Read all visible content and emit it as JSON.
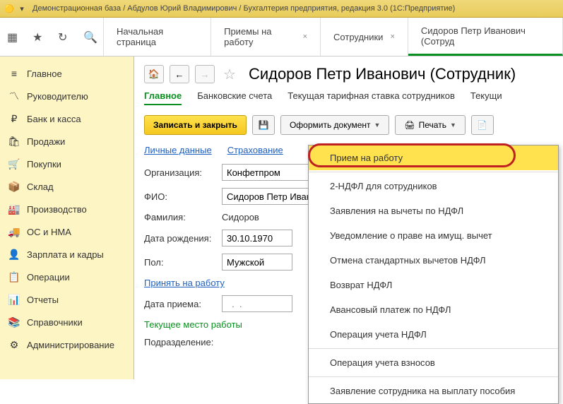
{
  "titlebar": {
    "text": "Демонстрационная база / Абдулов Юрий Владимирович / Бухгалтерия предприятия, редакция 3.0  (1С:Предприятие)"
  },
  "topTabs": {
    "t0": "Начальная страница",
    "t1": "Приемы на работу",
    "t2": "Сотрудники",
    "t3": "Сидоров Петр Иванович (Сотруд"
  },
  "sidebar": {
    "s0": "Главное",
    "s1": "Руководителю",
    "s2": "Банк и касса",
    "s3": "Продажи",
    "s4": "Покупки",
    "s5": "Склад",
    "s6": "Производство",
    "s7": "ОС и НМА",
    "s8": "Зарплата и кадры",
    "s9": "Операции",
    "s10": "Отчеты",
    "s11": "Справочники",
    "s12": "Администрирование"
  },
  "page": {
    "title": "Сидоров Петр Иванович (Сотрудник)"
  },
  "innerTabs": {
    "t0": "Главное",
    "t1": "Банковские счета",
    "t2": "Текущая тарифная ставка сотрудников",
    "t3": "Текущи"
  },
  "actions": {
    "save": "Записать и закрыть",
    "doc": "Оформить документ",
    "print": "Печать"
  },
  "subLinks": {
    "l0": "Личные данные",
    "l1": "Страхование"
  },
  "form": {
    "orgLabel": "Организация:",
    "orgValue": "Конфетпром",
    "fioLabel": "ФИО:",
    "fioValue": "Сидоров Петр Иванов",
    "famLabel": "Фамилия:",
    "famValue": "Сидоров",
    "dobLabel": "Дата рождения:",
    "dobValue": "30.10.1970",
    "genderLabel": "Пол:",
    "genderValue": "Мужской",
    "hireLink": "Принять на работу",
    "hireDateLabel": "Дата приема:",
    "workplaceLabel": "Текущее место работы",
    "depLabel": "Подразделение:"
  },
  "dropdown": {
    "d0": "Прием на работу",
    "d1": "2-НДФЛ для сотрудников",
    "d2": "Заявления на вычеты по НДФЛ",
    "d3": "Уведомление о праве на имущ. вычет",
    "d4": "Отмена стандартных вычетов НДФЛ",
    "d5": "Возврат НДФЛ",
    "d6": "Авансовый платеж по НДФЛ",
    "d7": "Операция учета НДФЛ",
    "d8": "Операция учета взносов",
    "d9": "Заявление сотрудника на выплату пособия"
  }
}
